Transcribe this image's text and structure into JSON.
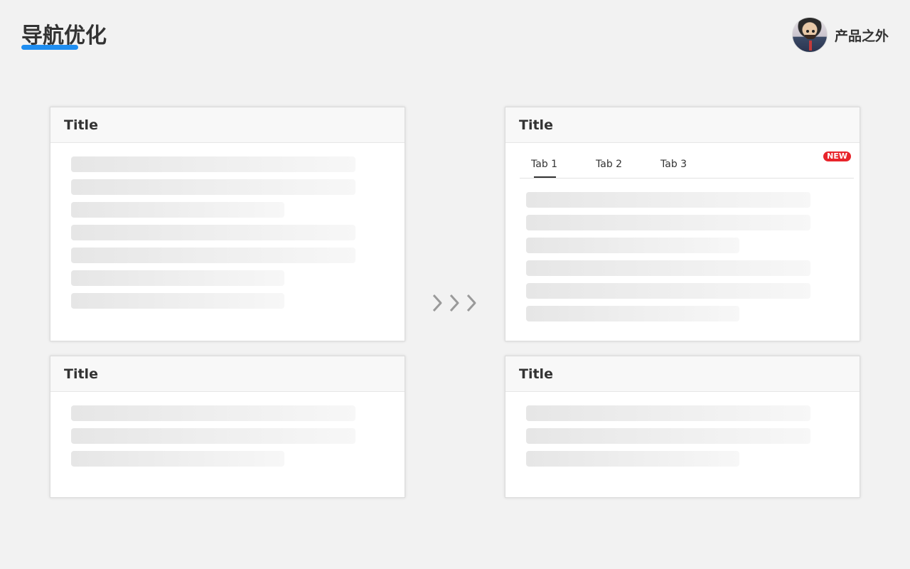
{
  "header": {
    "title": "导航优化",
    "brand_name": "产品之外",
    "accent_color": "#1f8ef1"
  },
  "before": {
    "top_card": {
      "title": "Title"
    },
    "bottom_card": {
      "title": "Title"
    }
  },
  "after": {
    "top_card": {
      "title": "Title",
      "tabs": [
        "Tab 1",
        "Tab 2",
        "Tab 3"
      ],
      "active_tab": "Tab 1",
      "badge": "NEW",
      "badge_color": "#e8242b"
    },
    "bottom_card": {
      "title": "Title"
    }
  },
  "transition_icon": "triple-chevron-right-icon"
}
